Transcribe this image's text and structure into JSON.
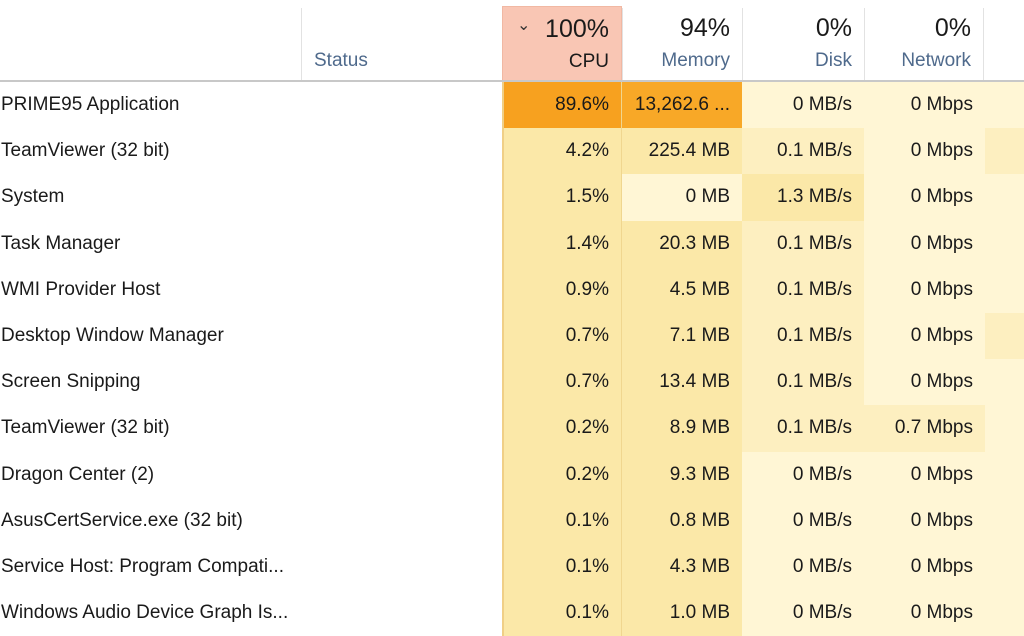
{
  "header": {
    "sort_indicator": "chevron-down",
    "status_label": "Status",
    "columns": [
      {
        "key": "cpu",
        "percent": "100%",
        "label": "CPU",
        "sorted": true
      },
      {
        "key": "memory",
        "percent": "94%",
        "label": "Memory"
      },
      {
        "key": "disk",
        "percent": "0%",
        "label": "Disk"
      },
      {
        "key": "network",
        "percent": "0%",
        "label": "Network"
      }
    ]
  },
  "colors": {
    "sorted_header_bg": "#f9c6b4",
    "high_usage": "#f7a11f",
    "heat_light": "#fff6d5",
    "heat_medium": "#fbe8a8",
    "header_label": "#4f6a8c"
  },
  "processes": [
    {
      "name": "PRIME95 Application",
      "cpu": "89.6%",
      "memory": "13,262.6 ...",
      "disk": "0 MB/s",
      "network": "0 Mbps",
      "heat": [
        "hot",
        "hot2",
        "lvl0",
        "lvl0",
        "lvl0"
      ]
    },
    {
      "name": "TeamViewer (32 bit)",
      "cpu": "4.2%",
      "memory": "225.4 MB",
      "disk": "0.1 MB/s",
      "network": "0 Mbps",
      "heat": [
        "lvl2",
        "lvl2",
        "lvl1",
        "lvl0",
        "lvl1"
      ]
    },
    {
      "name": "System",
      "cpu": "1.5%",
      "memory": "0 MB",
      "disk": "1.3 MB/s",
      "network": "0 Mbps",
      "heat": [
        "lvl2",
        "lvl0",
        "lvl2",
        "lvl0",
        "lvl0"
      ]
    },
    {
      "name": "Task Manager",
      "cpu": "1.4%",
      "memory": "20.3 MB",
      "disk": "0.1 MB/s",
      "network": "0 Mbps",
      "heat": [
        "lvl2",
        "lvl2",
        "lvl1",
        "lvl0",
        "lvl0"
      ]
    },
    {
      "name": "WMI Provider Host",
      "cpu": "0.9%",
      "memory": "4.5 MB",
      "disk": "0.1 MB/s",
      "network": "0 Mbps",
      "heat": [
        "lvl2",
        "lvl2",
        "lvl1",
        "lvl0",
        "lvl0"
      ]
    },
    {
      "name": "Desktop Window Manager",
      "cpu": "0.7%",
      "memory": "7.1 MB",
      "disk": "0.1 MB/s",
      "network": "0 Mbps",
      "heat": [
        "lvl2",
        "lvl2",
        "lvl1",
        "lvl0",
        "lvl1"
      ]
    },
    {
      "name": "Screen Snipping",
      "cpu": "0.7%",
      "memory": "13.4 MB",
      "disk": "0.1 MB/s",
      "network": "0 Mbps",
      "heat": [
        "lvl2",
        "lvl2",
        "lvl1",
        "lvl0",
        "lvl0"
      ]
    },
    {
      "name": "TeamViewer (32 bit)",
      "cpu": "0.2%",
      "memory": "8.9 MB",
      "disk": "0.1 MB/s",
      "network": "0.7 Mbps",
      "heat": [
        "lvl2",
        "lvl2",
        "lvl1",
        "lvl1",
        "lvl0"
      ]
    },
    {
      "name": "Dragon Center (2)",
      "cpu": "0.2%",
      "memory": "9.3 MB",
      "disk": "0 MB/s",
      "network": "0 Mbps",
      "heat": [
        "lvl2",
        "lvl2",
        "lvl0",
        "lvl0",
        "lvl0"
      ]
    },
    {
      "name": "AsusCertService.exe (32 bit)",
      "cpu": "0.1%",
      "memory": "0.8 MB",
      "disk": "0 MB/s",
      "network": "0 Mbps",
      "heat": [
        "lvl2",
        "lvl2",
        "lvl0",
        "lvl0",
        "lvl0"
      ]
    },
    {
      "name": "Service Host: Program Compati...",
      "cpu": "0.1%",
      "memory": "4.3 MB",
      "disk": "0 MB/s",
      "network": "0 Mbps",
      "heat": [
        "lvl2",
        "lvl2",
        "lvl0",
        "lvl0",
        "lvl0"
      ]
    },
    {
      "name": "Windows Audio Device Graph Is...",
      "cpu": "0.1%",
      "memory": "1.0 MB",
      "disk": "0 MB/s",
      "network": "0 Mbps",
      "heat": [
        "lvl2",
        "lvl2",
        "lvl0",
        "lvl0",
        "lvl0"
      ]
    }
  ]
}
